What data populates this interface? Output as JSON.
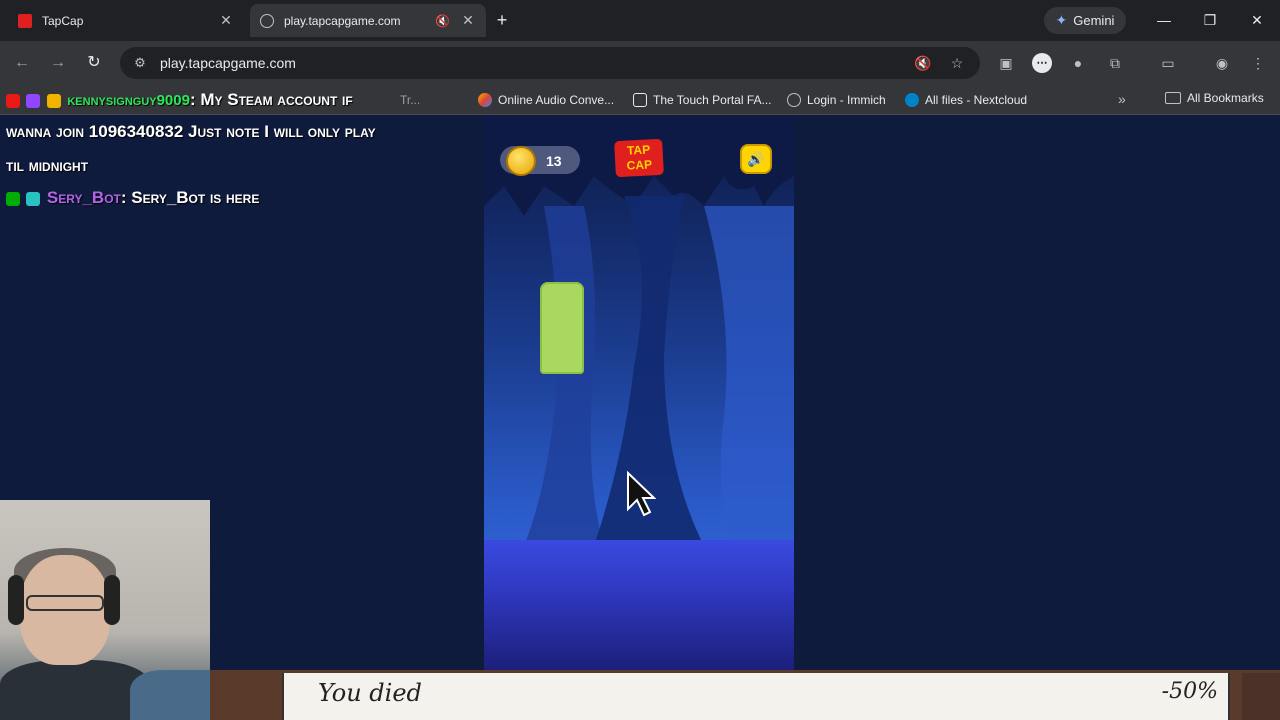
{
  "browser": {
    "tabs": [
      {
        "title": "TapCap",
        "active": false
      },
      {
        "title": "play.tapcapgame.com",
        "active": true
      }
    ],
    "gemini_label": "Gemini",
    "url": "play.tapcapgame.com",
    "bookmarks": [
      {
        "label": "Tr..."
      },
      {
        "label": "Online Audio Conve..."
      },
      {
        "label": "The Touch Portal FA..."
      },
      {
        "label": "Login - Immich"
      },
      {
        "label": "All files - Nextcloud"
      }
    ],
    "all_bookmarks_label": "All Bookmarks"
  },
  "chat": {
    "line1_user": "kennysignguy9009",
    "line1_msg": ": My Steam account if",
    "line2": "wanna join 1096340832 Just note I will only play",
    "line3": "til midnight",
    "line4_user": "Sery_Bot",
    "line4_msg": ": Sery_Bot is here"
  },
  "game": {
    "coins": "13",
    "logo_text_top": "TAP",
    "logo_text_bottom": "CAP"
  },
  "overlay": {
    "status": "You died",
    "percent": "-50%"
  },
  "colors": {
    "page_bg": "#0f1b3d",
    "chat_user1": "#2ee65a",
    "chat_user2": "#b264e6",
    "coin": "#f0b400",
    "logo_bg": "#e0201e",
    "cap_green": "#a8d860"
  }
}
